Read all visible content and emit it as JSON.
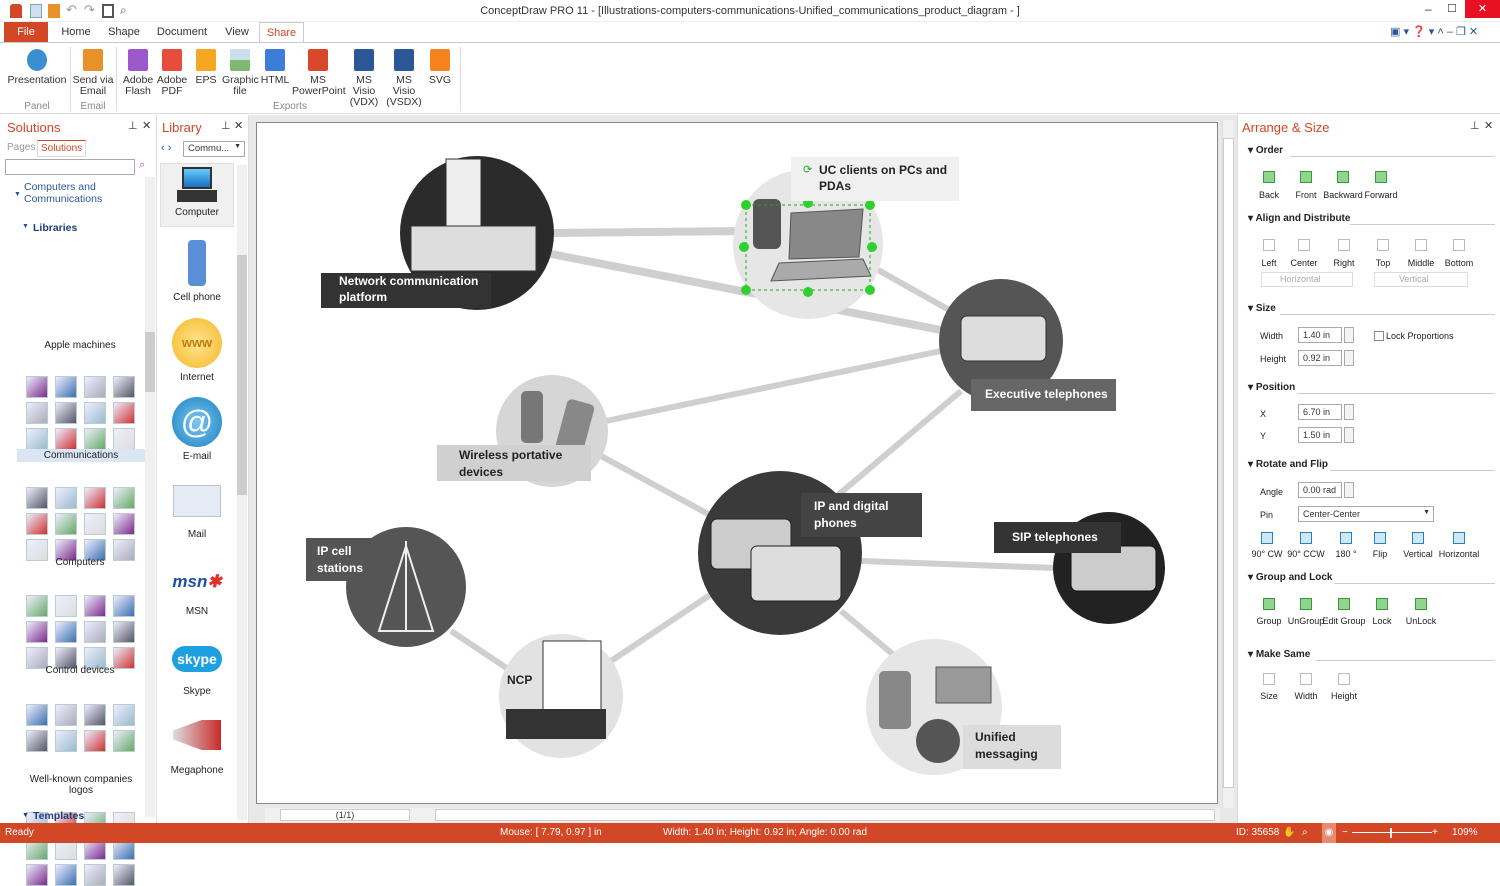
{
  "window": {
    "title": "ConceptDraw PRO 11 - [Illustrations-computers-communications-Unified_communications_product_diagram - ]"
  },
  "menu_tabs": [
    "File",
    "Home",
    "Shape",
    "Document",
    "View",
    "Share"
  ],
  "ribbon": {
    "buttons": [
      {
        "label": "Presentation",
        "icon": "presentation-icon",
        "color": "#3a8fd0"
      },
      {
        "label": "Send via Email",
        "icon": "email-icon",
        "color": "#e8902a"
      },
      {
        "label": "Adobe Flash",
        "icon": "swf-file-icon",
        "color": "#9b59c9"
      },
      {
        "label": "Adobe PDF",
        "icon": "pdf-file-icon",
        "color": "#e84c3d"
      },
      {
        "label": "EPS",
        "icon": "eps-file-icon",
        "color": "#f5a623"
      },
      {
        "label": "Graphic file",
        "icon": "image-file-icon",
        "color": "#7fb870"
      },
      {
        "label": "HTML",
        "icon": "html-file-icon",
        "color": "#3b7dd8"
      },
      {
        "label": "MS PowerPoint",
        "icon": "powerpoint-icon",
        "color": "#d9472b"
      },
      {
        "label": "MS Visio (VDX)",
        "icon": "visio-icon",
        "color": "#2b5797"
      },
      {
        "label": "MS Visio (VSDX)",
        "icon": "visio-icon",
        "color": "#2b5797"
      },
      {
        "label": "SVG",
        "icon": "svg-file-icon",
        "color": "#f5821f"
      }
    ],
    "groups": [
      "Panel",
      "Email",
      "Exports"
    ]
  },
  "solutions": {
    "title": "Solutions",
    "tabs": [
      "Pages",
      "Solutions"
    ],
    "search_placeholder": "",
    "tree_root": "Computers and Communications",
    "libraries_label": "Libraries",
    "libraries": [
      "Apple machines",
      "Communications",
      "Computers",
      "Control devices",
      "Well-known companies logos"
    ],
    "templates_label": "Templates"
  },
  "library": {
    "title": "Library",
    "dropdown": "Commu...",
    "items": [
      "Computer",
      "Cell phone",
      "Internet",
      "E-mail",
      "Mail",
      "MSN",
      "Skype",
      "Megaphone"
    ]
  },
  "diagram": {
    "nodes": {
      "network": "Network communication platform",
      "uc": "UC clients on PCs and PDAs",
      "exec": "Executive telephones",
      "wireless": "Wireless portative devices",
      "ipphones": "IP and digital phones",
      "sip": "SIP telephones",
      "ipcell": "IP cell stations",
      "ncp": "NCP",
      "unified": "Unified messaging"
    },
    "page_nav": "(1/1)"
  },
  "arrange": {
    "title": "Arrange & Size",
    "order": {
      "label": "Order",
      "buttons": [
        "Back",
        "Front",
        "Backward",
        "Forward"
      ]
    },
    "align": {
      "label": "Align and Distribute",
      "buttons": [
        "Left",
        "Center",
        "Right",
        "Top",
        "Middle",
        "Bottom"
      ],
      "horizontal": "Horizontal",
      "vertical": "Vertical"
    },
    "size": {
      "label": "Size",
      "width_label": "Width",
      "width": "1.40 in",
      "height_label": "Height",
      "height": "0.92 in",
      "lock": "Lock Proportions",
      "lock_checked": false
    },
    "position": {
      "label": "Position",
      "x_label": "X",
      "x": "6.70 in",
      "y_label": "Y",
      "y": "1.50 in"
    },
    "rotate": {
      "label": "Rotate and Flip",
      "angle_label": "Angle",
      "angle": "0.00 rad",
      "pin_label": "Pin",
      "pin": "Center-Center",
      "buttons": [
        "90° CW",
        "90° CCW",
        "180 °",
        "Flip",
        "Vertical",
        "Horizontal"
      ]
    },
    "group": {
      "label": "Group and Lock",
      "buttons": [
        "Group",
        "UnGroup",
        "Edit Group",
        "Lock",
        "UnLock"
      ]
    },
    "same": {
      "label": "Make Same",
      "buttons": [
        "Size",
        "Width",
        "Height"
      ]
    }
  },
  "status": {
    "ready": "Ready",
    "mouse": "Mouse: [ 7.79, 0.97 ] in",
    "dims": "Width: 1.40 in;  Height: 0.92 in;  Angle: 0.00 rad",
    "id": "ID: 35658",
    "zoom": "109%",
    "zoom_level": 1.09
  },
  "colors": {
    "accent": "#d24726"
  }
}
